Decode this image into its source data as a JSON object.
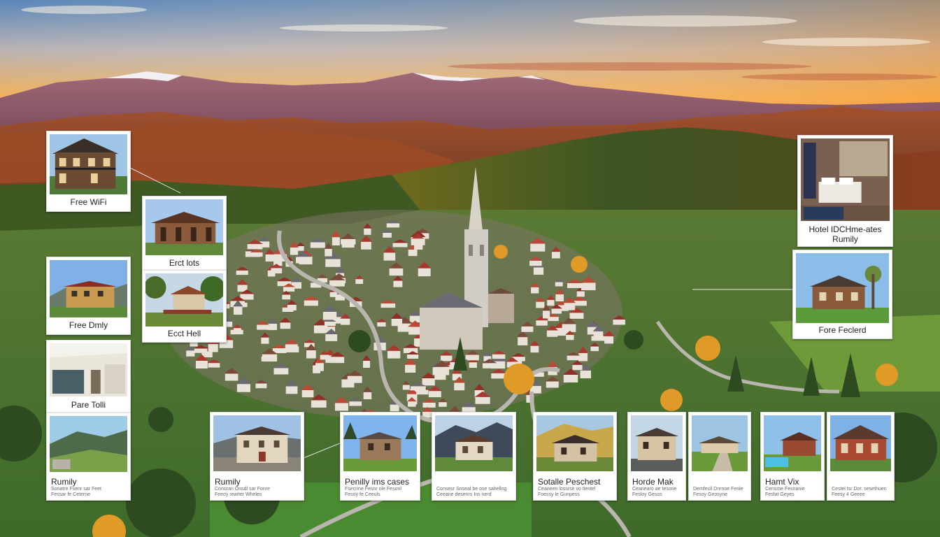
{
  "scene": {
    "description_colors": {
      "sky_top": "#5a86b8",
      "sky_sunset": "#f3a24a",
      "mountains": "#8a6070",
      "forest": "#3f5a22",
      "autumn": "#b0552a",
      "roofs": "#a8392e",
      "church": "#c8c4bc"
    }
  },
  "cards": [
    {
      "id": "free-wifi",
      "caption": "Free WiFi"
    },
    {
      "id": "erct-lots",
      "caption": "Erct lots"
    },
    {
      "id": "free-daily",
      "caption": "Free Dmly"
    },
    {
      "id": "ect-hell",
      "caption": "Ecct Hell"
    },
    {
      "id": "pare-toll",
      "caption": "Pare Tolli"
    },
    {
      "id": "hotel-family",
      "caption_line1": "Hotel IDCHme-ates",
      "caption_line2": "Rumily"
    },
    {
      "id": "fore-feclerd",
      "caption": "Fore Feclerd"
    },
    {
      "id": "rumily-1",
      "title": "Rumily",
      "desc_line1": "Sonatre Fsenr sar Feet",
      "desc_line2": "Fessar fe Ceterne"
    },
    {
      "id": "rumily-2",
      "title": "Rumily",
      "desc_line1": "Conoran Onsdl sar Fonre",
      "desc_line2": "Feeoy rearter Wheles"
    },
    {
      "id": "penilly",
      "title": "Penilly ims cases",
      "desc_line1": "Fsecrine Fesnr ole Fesonl",
      "desc_line2": "Fesoy fe Ceeuls"
    },
    {
      "id": "card-blank-1",
      "desc_line1": "Consesr Snseal be ose sahellng",
      "desc_line2": "Ceeane desenrs Ins nerd"
    },
    {
      "id": "sotalle",
      "title": "Sotalle Peschest",
      "desc_line1": "Ceaneen lossrse vo tlentel",
      "desc_line2": "Foessy le Gunpess"
    },
    {
      "id": "horde-mak",
      "title": "Horde Mak",
      "desc_line1": "Ceanearo ae tesone",
      "desc_line2": "Fesloy Gesos"
    },
    {
      "id": "card-blank-2",
      "desc_line1": "Demfecll Dnrnoe Fenle",
      "desc_line2": "Fesoy Geosyne"
    },
    {
      "id": "hamt-vix",
      "title": "Hamt Vix",
      "desc_line1": "Censme Fesnanie",
      "desc_line2": "Fesfat Geyes"
    },
    {
      "id": "card-blank-3",
      "desc_line1": "Cestel tsr Dor. sesethuen",
      "desc_line2": "Feesy 4 Geeee"
    }
  ]
}
